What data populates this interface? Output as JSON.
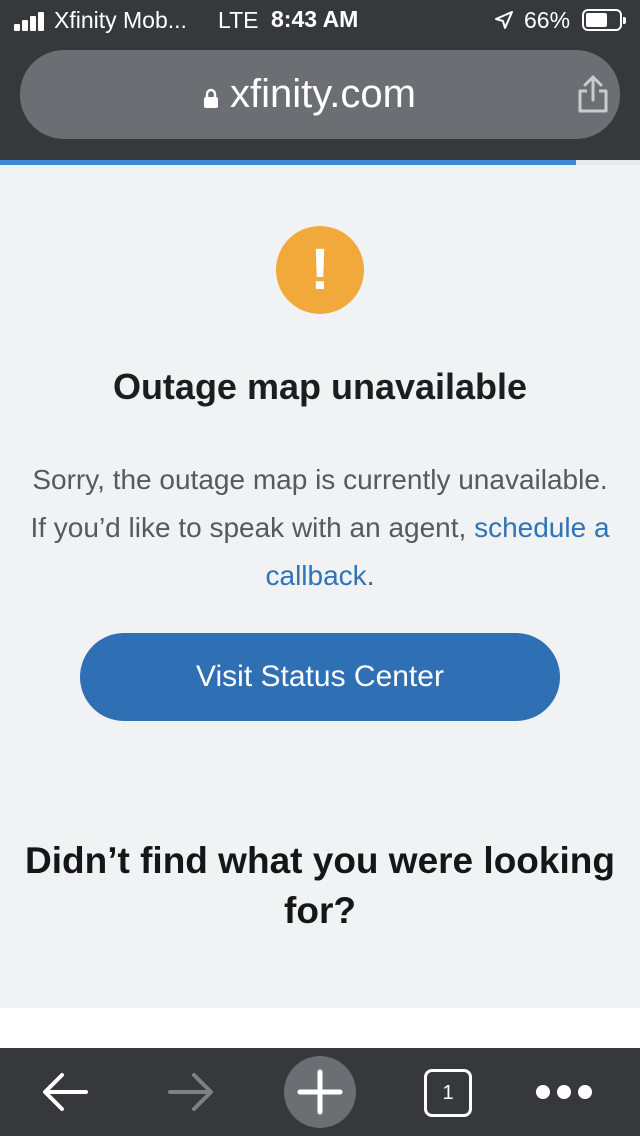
{
  "status_bar": {
    "carrier": "Xfinity Mob...",
    "network": "LTE",
    "time": "8:43 AM",
    "battery_percent": "66%",
    "battery_level": 0.66,
    "icons": [
      "signal-icon",
      "location-icon",
      "battery-icon"
    ]
  },
  "browser": {
    "url": "xfinity.com",
    "page_load_progress": 0.9,
    "icons": [
      "lock-icon",
      "share-icon"
    ]
  },
  "content": {
    "alert_icon_glyph": "!",
    "heading": "Outage map unavailable",
    "message_before": "Sorry, the outage map is currently unavailable. If you’d like to speak with an agent, ",
    "callback_link": "schedule a callback",
    "message_after": ".",
    "status_button_label": "Visit Status Center",
    "help_question": "Didn’t find what you were looking for?"
  },
  "toolbar": {
    "tab_count": "1",
    "icons": [
      "back-icon",
      "forward-icon",
      "new-tab-icon",
      "tabs-icon",
      "more-icon"
    ]
  },
  "colors": {
    "chrome": "#36383c",
    "alert": "#f2a93b",
    "primary_button": "#2f6fb4",
    "link": "#2f73b8",
    "progress": "#3e86d6"
  }
}
